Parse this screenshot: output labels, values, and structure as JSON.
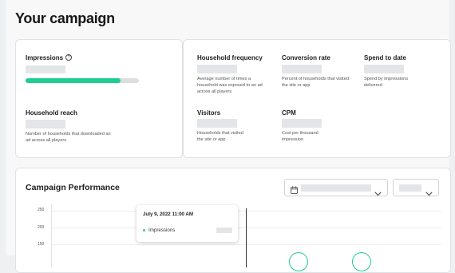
{
  "page_title": "Your campaign",
  "metrics": {
    "impressions": {
      "label": "Impressions",
      "progress": 0.84
    },
    "household_reach": {
      "label": "Household reach",
      "description": "Number of households that downloaded an ad across all players"
    },
    "household_frequency": {
      "label": "Household frequency",
      "description": "Average number of times a household was exposed to an ad across all players"
    },
    "conversion_rate": {
      "label": "Conversion rate",
      "description": "Percent of households that visited the site or app"
    },
    "spend_to_date": {
      "label": "Spend to date",
      "description": "Spend by impressions delivered"
    },
    "visitors": {
      "label": "Visitors",
      "description": "Households that visited the site or app"
    },
    "cpm": {
      "label": "CPM",
      "description": "Cost per thousand impression"
    }
  },
  "performance": {
    "title": "Campaign Performance",
    "icons": {
      "date": "calendar-icon",
      "dropdown": "chevron-down-icon",
      "info": "info-icon"
    },
    "y_ticks": [
      "250",
      "200",
      "150"
    ],
    "tooltip": {
      "date": "July 9, 2022 11:00 AM",
      "series": "Impressions"
    }
  },
  "colors": {
    "accent": "#1fcd93",
    "skeleton": "#e3e5e8"
  }
}
